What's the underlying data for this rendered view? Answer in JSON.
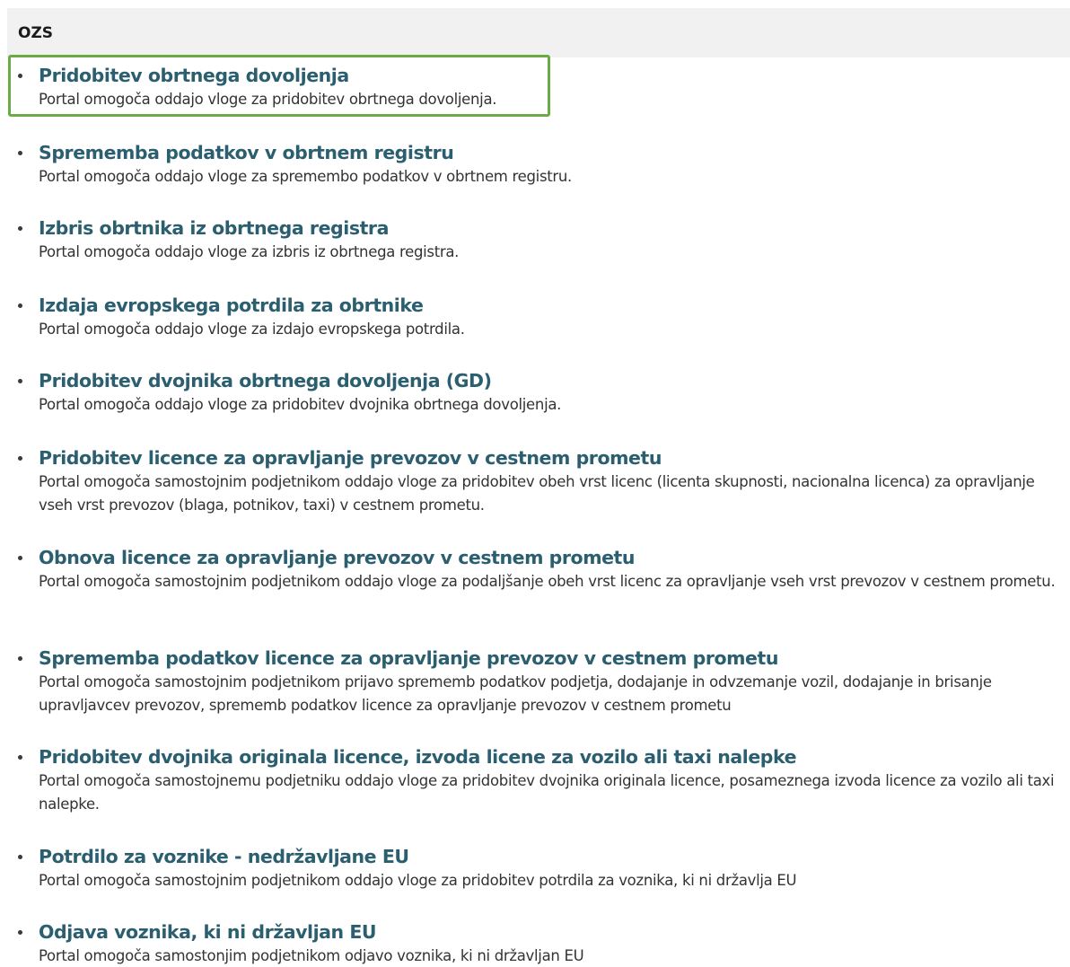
{
  "section": {
    "title": "OZS"
  },
  "services": [
    {
      "title": "Pridobitev obrtnega dovoljenja",
      "description": "Portal omogoča oddajo vloge za pridobitev obrtnega dovoljenja."
    },
    {
      "title": "Sprememba podatkov v obrtnem registru",
      "description": "Portal omogoča oddajo vloge za spremembo podatkov v obrtnem registru."
    },
    {
      "title": "Izbris obrtnika iz obrtnega registra",
      "description": "Portal omogoča oddajo vloge za izbris iz obrtnega registra."
    },
    {
      "title": "Izdaja evropskega potrdila za obrtnike",
      "description": "Portal omogoča oddajo vloge za izdajo evropskega potrdila."
    },
    {
      "title": "Pridobitev dvojnika obrtnega dovoljenja (GD)",
      "description": "Portal omogoča oddajo vloge za pridobitev dvojnika obrtnega dovoljenja."
    },
    {
      "title": "Pridobitev licence za opravljanje prevozov v cestnem prometu",
      "description": "Portal omogoča samostojnim podjetnikom oddajo vloge za pridobitev obeh vrst licenc (licenta skupnosti, nacionalna licenca) za opravljanje vseh vrst prevozov (blaga, potnikov, taxi) v cestnem prometu."
    },
    {
      "title": "Obnova licence za opravljanje prevozov v cestnem prometu",
      "description": "Portal omogoča samostojnim podjetnikom oddajo vloge za podaljšanje obeh vrst licenc za opravljanje vseh vrst prevozov v cestnem prometu."
    },
    {
      "title": "Sprememba podatkov licence za opravljanje prevozov v cestnem prometu",
      "description": "Portal omogoča samostojnim podjetnikom prijavo sprememb podatkov podjetja, dodajanje in odvzemanje vozil, dodajanje in brisanje upravljavcev prevozov, sprememb podatkov licence za opravljanje prevozov v cestnem prometu"
    },
    {
      "title": "Pridobitev dvojnika originala licence, izvoda licene za vozilo ali taxi nalepke",
      "description": "Portal omogoča samostojnemu podjetniku oddajo vloge za pridobitev dvojnika originala licence, posameznega izvoda licence za vozilo ali taxi nalepke."
    },
    {
      "title": "Potrdilo za voznike - nedržavljane EU",
      "description": "Portal omogoča samostojnim podjetnikom oddajo vloge za pridobitev potrdila za voznika, ki ni državlja EU"
    },
    {
      "title": "Odjava voznika, ki ni državljan EU",
      "description": "Portal omogoča samostonjim podjetnikom odjavo voznika, ki ni državljan EU"
    }
  ],
  "colors": {
    "link": "#2b5f70",
    "highlight": "#6aab45",
    "header_bg": "#f1f1f1"
  }
}
